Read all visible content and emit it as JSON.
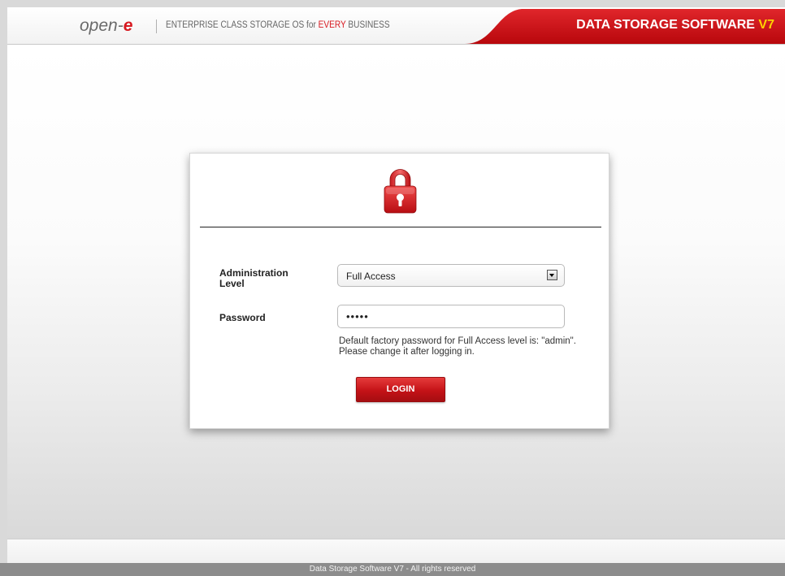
{
  "header": {
    "logo_text": "open-",
    "logo_e": "e",
    "tagline_prefix": "ENTERPRISE CLASS STORAGE OS for ",
    "tagline_highlight": "EVERY",
    "tagline_suffix": " BUSINESS",
    "product_title": "DATA STORAGE SOFTWARE ",
    "product_version": "V7"
  },
  "login": {
    "lock_icon": "padlock-icon",
    "admin_level_label": "Administration Level",
    "admin_level_value": "Full Access",
    "password_label": "Password",
    "password_value": "•••••",
    "hint": "Default factory password for Full Access level is: \"admin\". Please change it after logging in.",
    "login_button": "LOGIN"
  },
  "footer": {
    "text": "Data Storage Software V7 - All rights reserved"
  },
  "colors": {
    "brand_red": "#d71920",
    "version_yellow": "#ffd200",
    "footer_gray": "#8c8c8c"
  }
}
